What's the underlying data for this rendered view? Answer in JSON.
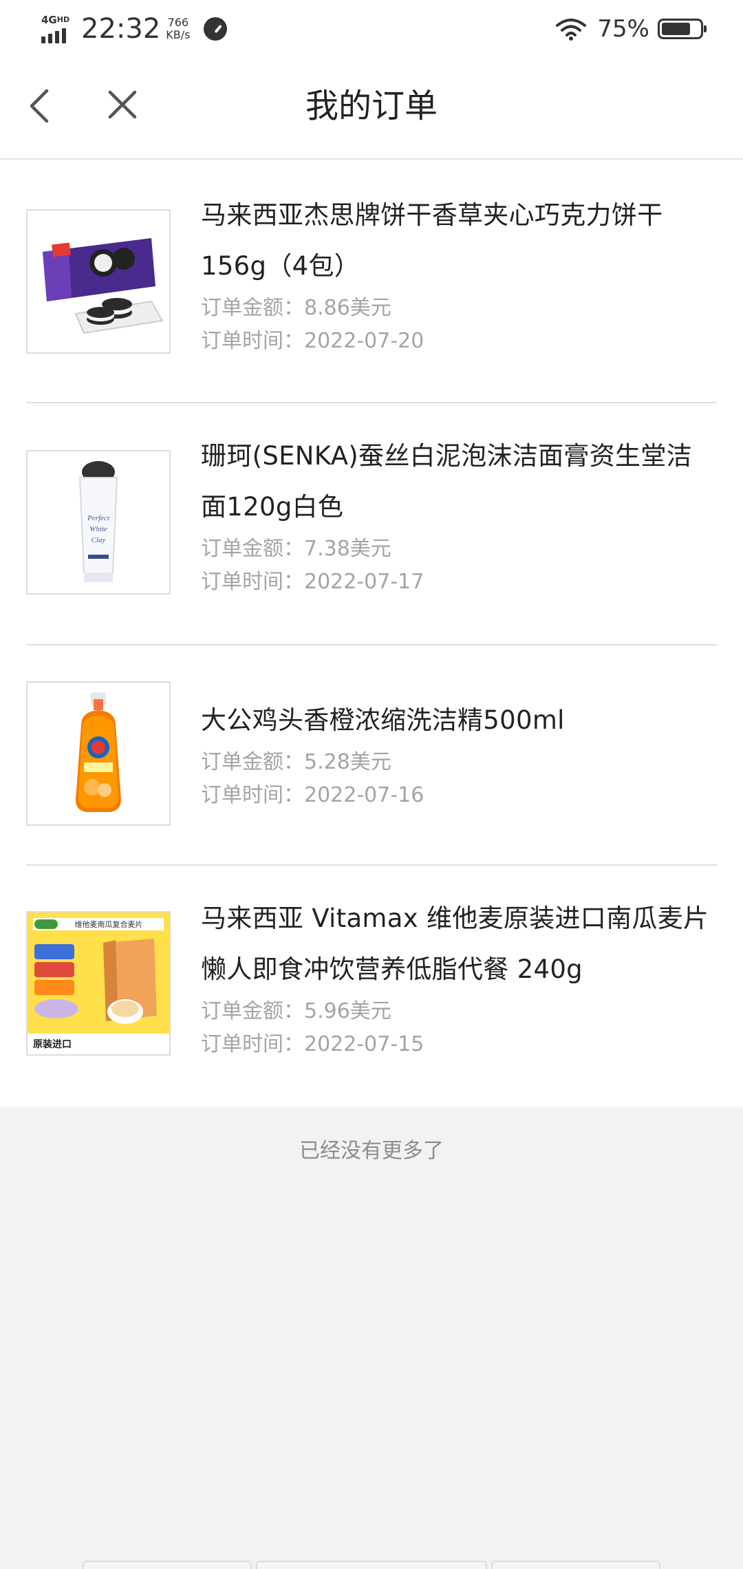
{
  "status_bar": {
    "network_type": "4G",
    "network_sub": "HD",
    "time": "22:32",
    "speed_value": "766",
    "speed_unit": "KB/s",
    "battery_percent": "75%",
    "battery_level": 0.75
  },
  "header": {
    "title": "我的订单",
    "back_icon": "chevron-left-icon",
    "close_icon": "close-icon"
  },
  "orders": [
    {
      "name": "马来西亚杰思牌饼干香草夹心巧克力饼干156g（4包）",
      "amount": "订单金额：8.86美元",
      "time": "订单时间：2022-07-20",
      "image_icon": "cookie-pack-image"
    },
    {
      "name": "珊珂(SENKA)蚕丝白泥泡沫洁面膏资生堂洁面120g白色",
      "amount": "订单金额：7.38美元",
      "time": "订单时间：2022-07-17",
      "image_icon": "cleanser-tube-image",
      "image_text": "Perfect White Clay"
    },
    {
      "name": "大公鸡头香橙浓缩洗洁精500ml",
      "amount": "订单金额：5.28美元",
      "time": "订单时间：2022-07-16",
      "image_icon": "detergent-bottle-image"
    },
    {
      "name": "马来西亚 Vitamax 维他麦原装进口南瓜麦片懒人即食冲饮营养低脂代餐 240g",
      "amount": "订单金额：5.96美元",
      "time": "订单时间：2022-07-15",
      "image_icon": "cereal-box-image",
      "image_text": "维他麦南瓜复合麦片",
      "image_badge": "原装进口"
    }
  ],
  "footer_note": "已经没有更多了",
  "colors": {
    "text_primary": "#222222",
    "text_secondary": "#a4a4a4",
    "background": "#f2f2f4",
    "divider": "#dedede"
  }
}
